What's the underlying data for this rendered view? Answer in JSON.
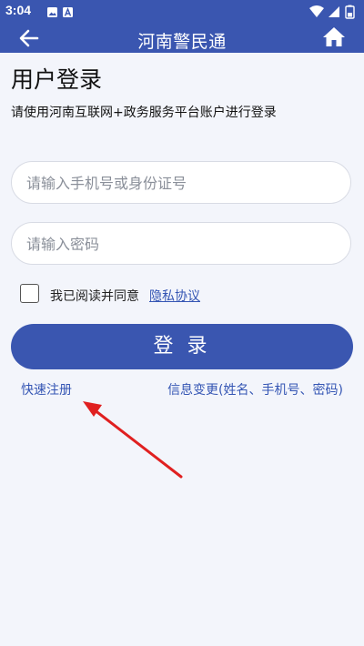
{
  "status_bar": {
    "time": "3:04",
    "icons": [
      "image-icon",
      "a-notification-icon",
      "wifi-icon",
      "signal-icon",
      "battery-icon"
    ]
  },
  "app_bar": {
    "title": "河南警民通",
    "back_icon": "arrow-left-icon",
    "home_icon": "home-icon"
  },
  "login": {
    "title": "用户登录",
    "subtitle": "请使用河南互联网+政务服务平台账户进行登录",
    "phone_placeholder": "请输入手机号或身份证号",
    "phone_value": "",
    "password_placeholder": "请输入密码",
    "password_value": "",
    "agree_checked": false,
    "agree_text": "我已阅读并同意",
    "privacy_link": "隐私协议",
    "submit_label": "登 录",
    "quick_register": "快速注册",
    "info_change": "信息变更(姓名、手机号、密码)"
  },
  "colors": {
    "primary": "#3a56b0",
    "link": "#3556b4",
    "background": "#f3f5fb",
    "annotation_arrow": "#e02020"
  }
}
